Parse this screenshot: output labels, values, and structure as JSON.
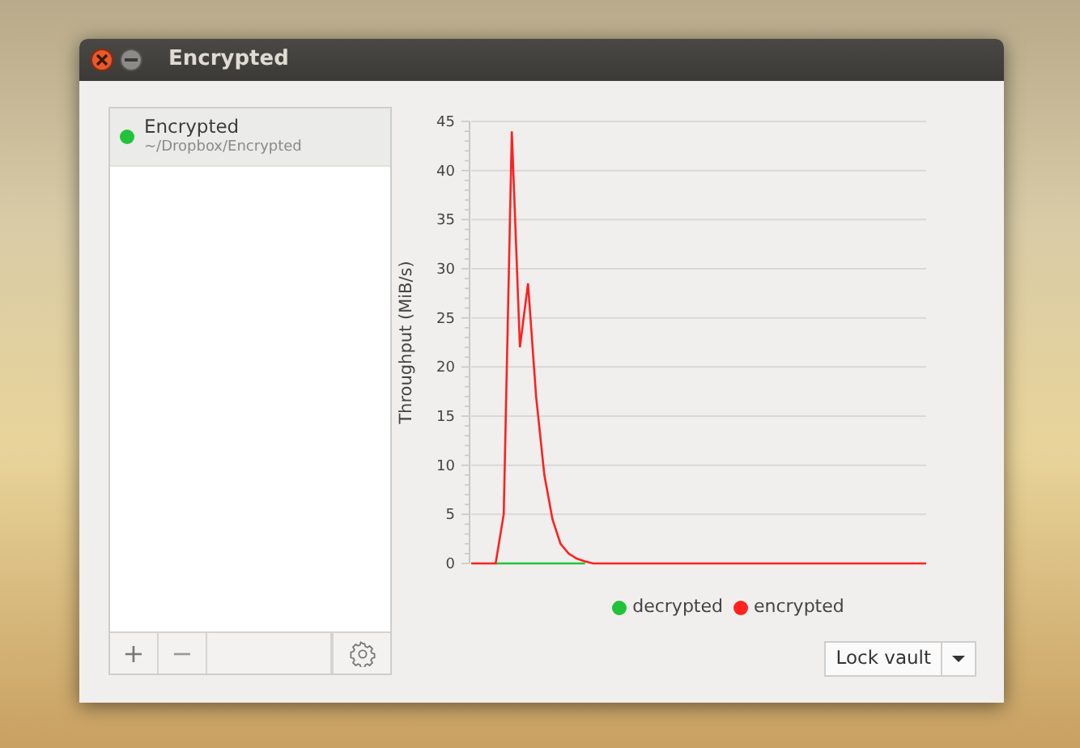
{
  "window": {
    "title": "Encrypted"
  },
  "vaults": [
    {
      "name": "Encrypted",
      "path": "~/Dropbox/Encrypted",
      "selected": true,
      "color": "#22c33a"
    }
  ],
  "list_toolbar": [
    {
      "kind": "add",
      "label": "+"
    },
    {
      "kind": "remove",
      "label": "−",
      "disabled": true
    },
    {
      "kind": "spacer"
    },
    {
      "kind": "settings"
    }
  ],
  "chart": {
    "chart_data": {
      "type": "line",
      "ylabel": "Throughput (MiB/s)",
      "grid": true,
      "ylim": [
        0,
        45
      ],
      "yticks": [
        0,
        5,
        10,
        15,
        20,
        25,
        30,
        35,
        40,
        45
      ],
      "series": [
        {
          "name": "decrypted",
          "color": "#22c33a",
          "values": [
            null,
            null,
            null,
            0,
            0,
            0,
            0,
            0,
            0,
            0,
            0,
            0,
            0,
            0,
            0,
            null,
            null,
            null,
            null,
            null,
            null,
            null,
            null,
            null,
            null,
            null,
            null,
            null,
            null,
            null,
            null,
            null,
            null,
            null,
            null,
            null,
            null,
            null,
            null,
            null,
            null,
            null,
            null,
            null,
            null,
            null,
            null,
            null,
            null,
            null,
            null,
            null,
            null,
            null,
            null,
            null,
            null
          ]
        },
        {
          "name": "encrypted",
          "color": "#ff2020",
          "values": [
            0,
            0,
            0,
            0,
            5,
            44,
            22,
            28.5,
            17,
            9,
            4.5,
            2,
            1,
            0.5,
            0.2,
            0,
            0,
            0,
            0,
            0,
            0,
            0,
            0,
            0,
            0,
            0,
            0,
            0,
            0,
            0,
            0,
            0,
            0,
            0,
            0,
            0,
            0,
            0,
            0,
            0,
            0,
            0,
            0,
            0,
            0,
            0,
            0,
            0,
            0,
            0,
            0,
            0,
            0,
            0,
            0,
            0,
            0
          ]
        }
      ]
    }
  },
  "lock_button": {
    "label": "Lock vault"
  }
}
